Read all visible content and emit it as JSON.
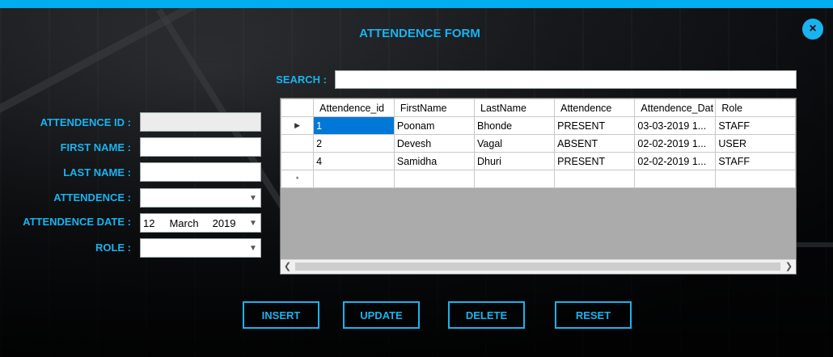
{
  "title": "ATTENDENCE FORM",
  "close_label": "×",
  "search": {
    "label": "SEARCH :",
    "value": ""
  },
  "form": {
    "attendence_id": {
      "label": "ATTENDENCE ID :",
      "value": ""
    },
    "first_name": {
      "label": "FIRST NAME :",
      "value": ""
    },
    "last_name": {
      "label": "LAST NAME :",
      "value": ""
    },
    "attendence": {
      "label": "ATTENDENCE :",
      "value": ""
    },
    "attendence_date": {
      "label": "ATTENDENCE DATE :",
      "day": "12",
      "month": "March",
      "year": "2019"
    },
    "role": {
      "label": "ROLE :",
      "value": ""
    }
  },
  "grid": {
    "columns": [
      "Attendence_id",
      "FirstName",
      "LastName",
      "Attendence",
      "Attendence_Dat",
      "Role"
    ],
    "rows": [
      [
        "1",
        "Poonam",
        "Bhonde",
        "PRESENT",
        "03-03-2019 1...",
        "STAFF"
      ],
      [
        "2",
        "Devesh",
        "Vagal",
        "ABSENT",
        "02-02-2019 1...",
        "USER"
      ],
      [
        "4",
        "Samidha",
        "Dhuri",
        "PRESENT",
        "02-02-2019 1...",
        "STAFF"
      ]
    ],
    "current_row_marker": "▶",
    "new_row_marker": "*"
  },
  "buttons": {
    "insert": "INSERT",
    "update": "UPDATE",
    "delete": "DELETE",
    "reset": "RESET"
  },
  "icons": {
    "dropdown": "chevron-down-icon",
    "scroll_left": "arrow-left-icon",
    "scroll_right": "arrow-right-icon"
  },
  "colors": {
    "accent": "#19b3f0",
    "topbar": "#00aeef",
    "selection": "#0078d7"
  }
}
